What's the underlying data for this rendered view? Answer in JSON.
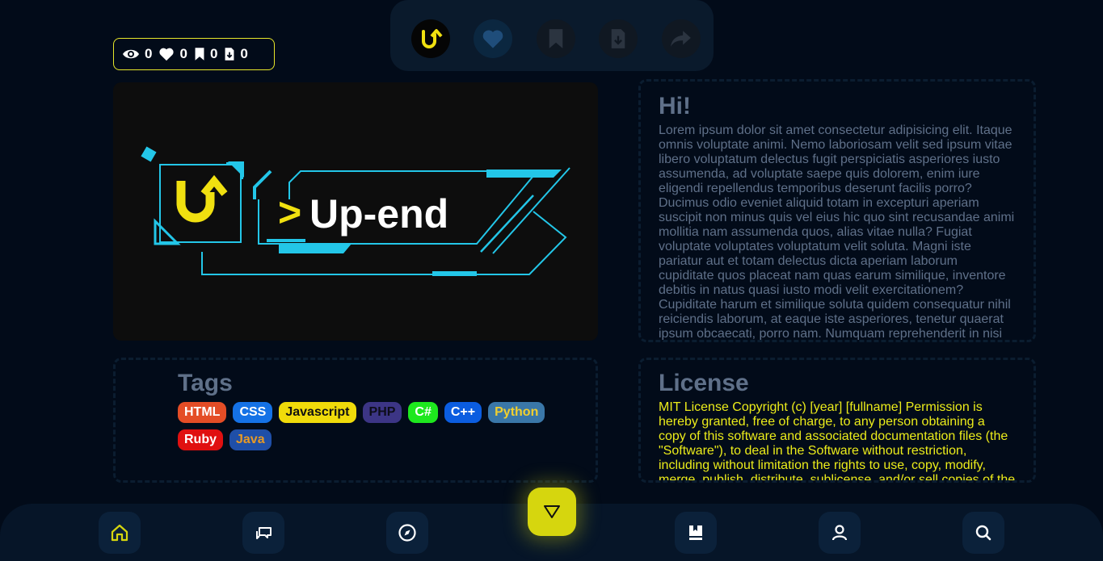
{
  "top_actions": [
    {
      "name": "logo",
      "icon": "up-logo-icon"
    },
    {
      "name": "like",
      "icon": "heart-icon"
    },
    {
      "name": "bookmark",
      "icon": "bookmark-icon"
    },
    {
      "name": "download",
      "icon": "download-icon"
    },
    {
      "name": "share",
      "icon": "share-icon"
    }
  ],
  "stats": {
    "views": "0",
    "likes": "0",
    "bookmarks": "0",
    "downloads": "0"
  },
  "banner": {
    "brand": "Up-end",
    "prompt_glyph": ">",
    "logo_letter": "U"
  },
  "intro": {
    "title": "Hi!",
    "body": "Lorem ipsum dolor sit amet consectetur adipisicing elit. Itaque omnis voluptate animi. Nemo laboriosam velit sed ipsum vitae libero voluptatum delectus fugit perspiciatis asperiores iusto assumenda, ad voluptate saepe quis dolorem, enim iure eligendi repellendus temporibus deserunt facilis porro? Ducimus odio eveniet aliquid totam in excepturi aperiam suscipit non minus quis vel eius hic quo sint recusandae animi mollitia nam assumenda quos, alias vitae nulla? Fugiat voluptate voluptates voluptatum velit soluta. Magni iste pariatur aut et totam delectus dicta aperiam laborum cupiditate quos placeat nam quas earum similique, inventore debitis in natus quasi iusto modi velit exercitationem? Cupiditate harum et similique soluta quidem consequatur nihil reiciendis laborum, at eaque iste asperiores, tenetur quaerat ipsum obcaecati, porro nam. Numquam reprehenderit in nisi"
  },
  "tags": {
    "title": "Tags",
    "items": [
      {
        "label": "HTML",
        "bg": "#e44d26",
        "fg": "#ffffff"
      },
      {
        "label": "CSS",
        "bg": "#1572e6",
        "fg": "#ffffff"
      },
      {
        "label": "Javascript",
        "bg": "#f0db0a",
        "fg": "#111111"
      },
      {
        "label": "PHP",
        "bg": "#3c3585",
        "fg": "#0d0d1a"
      },
      {
        "label": "C#",
        "bg": "#1ee81e",
        "fg": "#ffffff"
      },
      {
        "label": "C++",
        "bg": "#0b5de0",
        "fg": "#ffffff"
      },
      {
        "label": "Python",
        "bg": "#3a77a8",
        "fg": "#f1cf2e"
      },
      {
        "label": "Ruby",
        "bg": "#e01010",
        "fg": "#ffffff"
      },
      {
        "label": "Java",
        "bg": "#1f4fa8",
        "fg": "#e89a24"
      }
    ]
  },
  "license": {
    "title": "License",
    "body": "MIT License Copyright (c) [year] [fullname] Permission is hereby granted, free of charge, to any person obtaining a copy of this software and associated documentation files (the \"Software\"), to deal in the Software without restriction, including without limitation the rights to use, copy, modify, merge, publish, distribute, sublicense, and/or sell copies of the"
  },
  "bottom_nav": [
    {
      "name": "home",
      "icon": "home-icon",
      "active": true
    },
    {
      "name": "chat",
      "icon": "chat-icon"
    },
    {
      "name": "explore",
      "icon": "compass-icon"
    },
    {
      "name": "library",
      "icon": "book-icon"
    },
    {
      "name": "profile",
      "icon": "user-icon"
    },
    {
      "name": "search",
      "icon": "search-icon"
    }
  ],
  "fab": {
    "icon": "triangle-down-icon"
  },
  "colors": {
    "accent": "#d6d60e",
    "background": "#020b19",
    "muted_text": "#5f7089",
    "license_text": "#ecec1a",
    "cyan": "#23c6e8"
  }
}
